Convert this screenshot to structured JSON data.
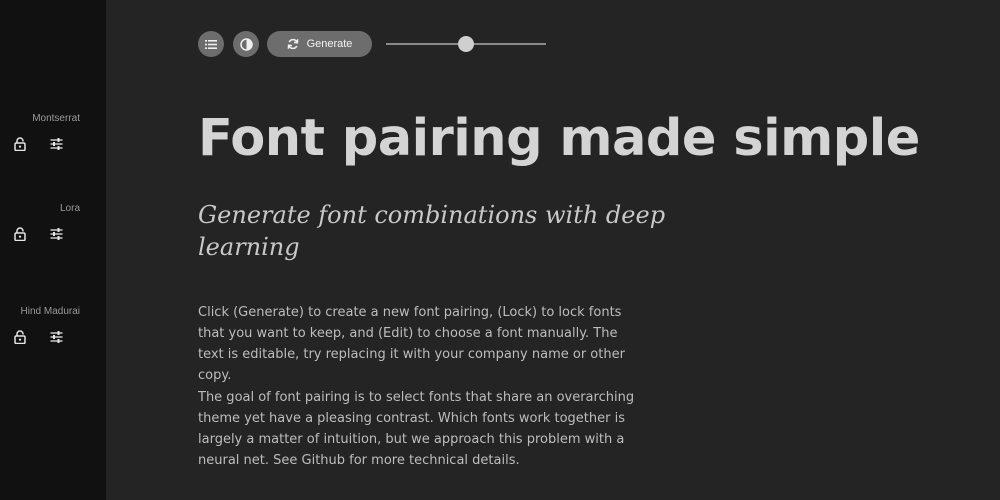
{
  "sidebar": {
    "fonts": [
      {
        "name": "Montserrat"
      },
      {
        "name": "Lora"
      },
      {
        "name": "Hind Madurai"
      }
    ]
  },
  "toolbar": {
    "list_icon": "list-icon",
    "contrast_icon": "contrast-icon",
    "generate_icon": "refresh-icon",
    "generate_label": "Generate",
    "slider_value": 0.5
  },
  "main": {
    "headline": "Font pairing made simple",
    "subheading": "Generate font combinations with deep learning",
    "paragraphs": [
      "Click (Generate) to create a new font pairing, (Lock) to lock fonts that you want to keep, and (Edit) to choose a font manually. The text is editable, try replacing it with your company name or other copy.",
      "The goal of font pairing is to select fonts that share an overarching theme yet have a pleasing contrast. Which fonts work together is largely a matter of intuition, but we approach this problem with a neural net. See Github for more technical details."
    ]
  },
  "colors": {
    "sidebar_bg": "#111111",
    "main_bg": "#242424",
    "button_bg": "#6d6d6d",
    "text": "#d4d4d4"
  }
}
